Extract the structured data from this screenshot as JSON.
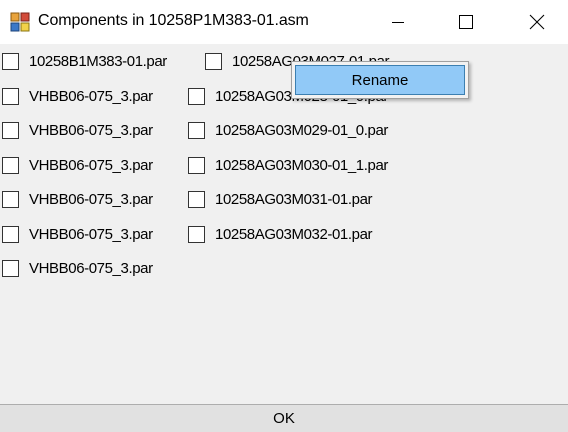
{
  "window": {
    "title": "Components in 10258P1M383-01.asm",
    "icon": "components-app-icon",
    "controls": [
      "minimize-icon",
      "maximize-icon",
      "close-icon"
    ]
  },
  "components": {
    "column1": [
      "10258B1M383-01.par",
      "VHBB06-075_3.par",
      "VHBB06-075_3.par",
      "VHBB06-075_3.par",
      "VHBB06-075_3.par",
      "VHBB06-075_3.par",
      "VHBB06-075_3.par"
    ],
    "column2": [
      "10258AG03M027-01.par",
      "10258AG03M028-01_0.par",
      "10258AG03M029-01_0.par",
      "10258AG03M030-01_1.par",
      "10258AG03M031-01.par",
      "10258AG03M032-01.par"
    ]
  },
  "context_menu": {
    "items": [
      "Rename"
    ]
  },
  "footer": {
    "ok_label": "OK"
  },
  "colors": {
    "menu_highlight": "#91c9f7",
    "menu_highlight_border": "#3c7fb1"
  }
}
